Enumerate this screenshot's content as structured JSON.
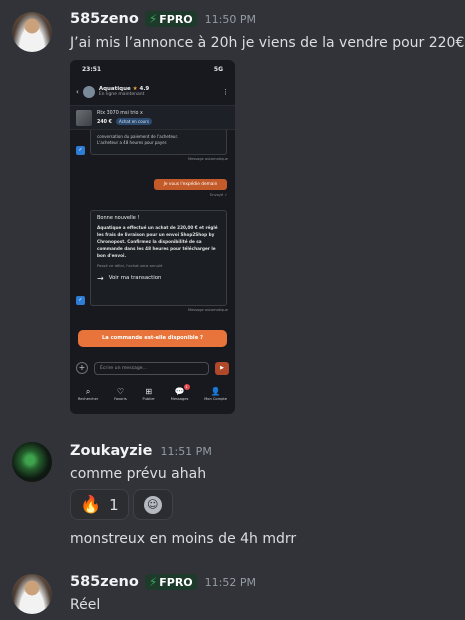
{
  "messages": [
    {
      "username": "585zeno",
      "tag": "FPRO",
      "time": "11:50 PM",
      "text": "J’ai mis l’annonce à 20h je viens de la vendre pour 220€"
    },
    {
      "username": "Zoukayzie",
      "time": "11:51 PM",
      "text": "comme prévu ahah",
      "followup": "monstreux en moins de 4h mdrr"
    },
    {
      "username": "585zeno",
      "tag": "FPRO",
      "time": "11:52 PM",
      "text": "Réel"
    }
  ],
  "reactions": [
    {
      "emoji": "🔥",
      "count": "1"
    }
  ],
  "add_reaction_icon": "smiley-add-icon",
  "colors": {
    "background": "#313338",
    "tag_bolt": "#3ba55d",
    "cta": "#e8743b"
  },
  "embed": {
    "status_time": "23:51",
    "status_icons": "5G",
    "seller_name": "Aquatique",
    "seller_rating": "4.9",
    "seller_status": "En ligne maintenant",
    "item_title": "Rtx 3070 msi trio x",
    "item_price": "240 €",
    "item_status": "Achat en cours",
    "top_card_line1": "conversation du paiement de l'acheteur.",
    "top_card_line2": "L'acheteur a 48 heures pour payer.",
    "auto_msg": "Message automatique",
    "bubble": "Je vous l'expédie demain",
    "bubble_meta": "Envoyé ✓",
    "card_title": "Bonne nouvelle !",
    "card_body": "Aquatique a effectué un achat de 220,00 € et réglé les frais de livraison pour un envoi Shop2Shop by Chronopost. Confirmez la disponibilité de sa commande dans les 48 heures pour télécharger le bon d'envoi.",
    "card_note": "Passé ce délai, l'achat sera annulé",
    "card_link": "Voir ma transaction",
    "cta": "La commande est-elle disponible ?",
    "input_placeholder": "Écrire un message...",
    "nav": [
      {
        "icon": "search-icon",
        "label": "Rechercher"
      },
      {
        "icon": "heart-icon",
        "label": "Favoris"
      },
      {
        "icon": "plus-square-icon",
        "label": "Publier"
      },
      {
        "icon": "chat-icon",
        "label": "Messages",
        "badge": "1"
      },
      {
        "icon": "user-icon",
        "label": "Mon Compte"
      }
    ]
  }
}
